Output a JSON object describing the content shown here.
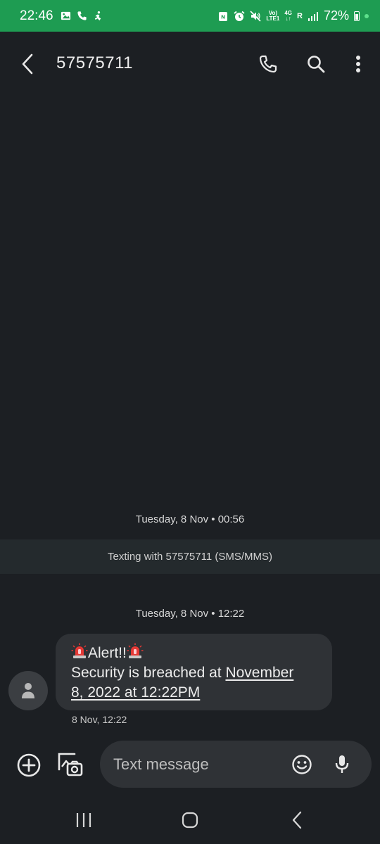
{
  "status_bar": {
    "time": "22:46",
    "net_volte": "Vo)",
    "net_lte": "LTE1",
    "net_4g": "4G",
    "net_r": "R",
    "battery": "72%"
  },
  "app_bar": {
    "title": "57575711",
    "icons": [
      "back-arrow-icon",
      "phone-icon",
      "search-icon",
      "more-vert-icon"
    ]
  },
  "conversation": {
    "first_date": "Tuesday, 8 Nov • 00:56",
    "texting_banner": "Texting with 57575711 (SMS/MMS)",
    "second_date": "Tuesday, 8 Nov • 12:22",
    "message": {
      "alert": "Alert!!",
      "body_prefix": "Security is breached at ",
      "link_line1": "November",
      "link_line2": "8, 2022 at 12:22PM",
      "timestamp": "8 Nov, 12:22"
    }
  },
  "composer": {
    "placeholder": "Text message"
  },
  "colors": {
    "status_bar_bg": "#1e9c52",
    "background": "#1c1f23",
    "bubble_bg": "#2f3236"
  }
}
